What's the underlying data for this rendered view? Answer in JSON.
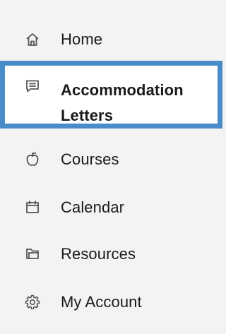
{
  "sidebar": {
    "items": [
      {
        "label": "Home",
        "icon": "home-icon",
        "active": false
      },
      {
        "label_line1": "Accommodation",
        "label_line2": "Letters",
        "icon": "message-icon",
        "active": true
      },
      {
        "label": "Courses",
        "icon": "apple-icon",
        "active": false
      },
      {
        "label": "Calendar",
        "icon": "calendar-icon",
        "active": false
      },
      {
        "label": "Resources",
        "icon": "folder-icon",
        "active": false
      },
      {
        "label": "My Account",
        "icon": "gear-icon",
        "active": false
      }
    ]
  },
  "colors": {
    "background": "#f3f3f3",
    "active_border": "#4a8bc9",
    "active_background": "#ffffff",
    "text": "#1a1a1a",
    "icon": "#555555"
  }
}
